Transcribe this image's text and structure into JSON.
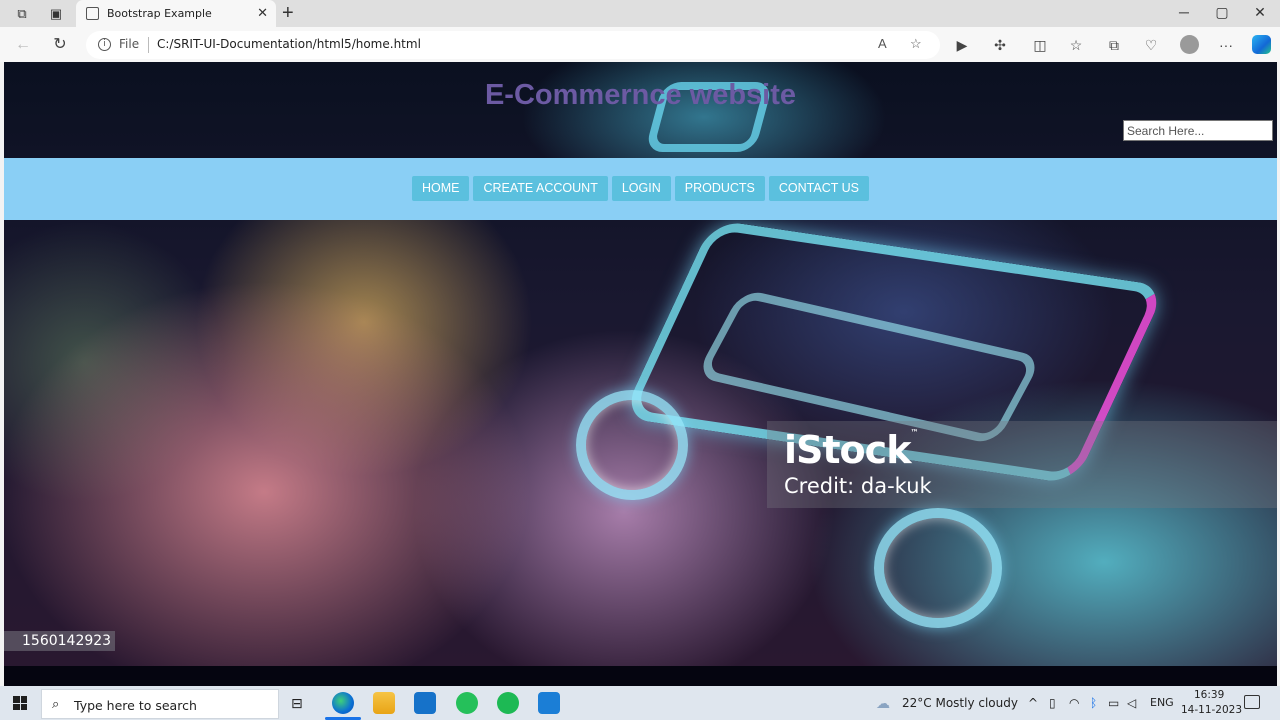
{
  "browser": {
    "tab_title": "Bootstrap Example",
    "file_label": "File",
    "url": "C:/SRIT-UI-Documentation/html5/home.html"
  },
  "site": {
    "title": "E-Commernce website",
    "search_placeholder": "Search Here...",
    "nav": [
      "HOME",
      "CREATE ACCOUNT",
      "LOGIN",
      "PRODUCTS",
      "CONTACT US"
    ],
    "watermark_brand": "iStock",
    "watermark_tm": "™",
    "watermark_credit": "Credit: da-kuk",
    "image_id": "1560142923"
  },
  "taskbar": {
    "search_placeholder": "Type here to search",
    "weather": "22°C  Mostly cloudy",
    "language": "ENG",
    "time": "16:39",
    "date": "14-11-2023"
  },
  "colors": {
    "nav_band": "#8acff5",
    "nav_button": "#5bc0de",
    "title": "#6c5aa3"
  }
}
